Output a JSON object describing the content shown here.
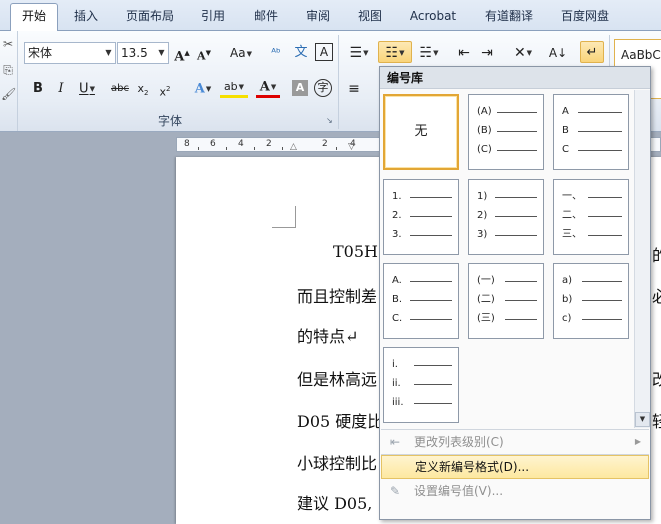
{
  "tabs": [
    "开始",
    "插入",
    "页面布局",
    "引用",
    "邮件",
    "审阅",
    "视图",
    "Acrobat",
    "有道翻译",
    "百度网盘"
  ],
  "font": {
    "name": "宋体",
    "size": "13.5",
    "group_label": "字体"
  },
  "styles": {
    "preview": "AaBbCc"
  },
  "ruler": {
    "numbers": [
      "8",
      "6",
      "4",
      "2",
      "",
      "2",
      "4"
    ]
  },
  "document": {
    "lines": [
      {
        "text": "T05H",
        "right": "的"
      },
      {
        "text": "而且控制差",
        "right": "必"
      },
      {
        "text": "的特点↵",
        "right": ""
      },
      {
        "text": "但是林高远",
        "right": "改"
      },
      {
        "text": "D05 硬度比",
        "right": "轻"
      },
      {
        "text": "小球控制比",
        "right": ""
      },
      {
        "text": "建议 D05,",
        "right": ""
      }
    ]
  },
  "numbering_popup": {
    "title": "编号库",
    "none_label": "无",
    "formats": [
      [
        "(A)",
        "(B)",
        "(C)"
      ],
      [
        "A",
        "B",
        "C"
      ],
      [
        "1.",
        "2.",
        "3."
      ],
      [
        "1)",
        "2)",
        "3)"
      ],
      [
        "一、",
        "二、",
        "三、"
      ],
      [
        "A.",
        "B.",
        "C."
      ],
      [
        "(一)",
        "(二)",
        "(三)"
      ],
      [
        "a)",
        "b)",
        "c)"
      ],
      [
        "i.",
        "ii.",
        "iii."
      ]
    ],
    "menu": {
      "change_level": "更改列表级别(C)",
      "define_new": "定义新编号格式(D)...",
      "set_value": "设置编号值(V)..."
    }
  },
  "colors": {
    "accent": "#f9d47a",
    "tab_bg": "#dfe8f4",
    "highlight": "#fde8a0"
  }
}
